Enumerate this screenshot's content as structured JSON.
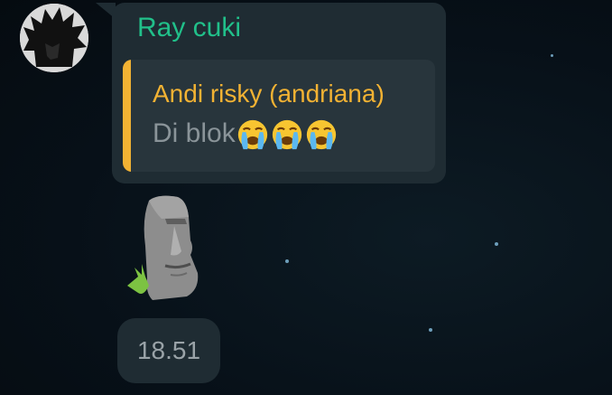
{
  "message": {
    "sender": "Ray cuki",
    "quoted": {
      "author": "Andi risky (andriana)",
      "text": "Di blok",
      "emojis": [
        "loudly-crying-face",
        "loudly-crying-face",
        "loudly-crying-face"
      ]
    },
    "sticker": "moai-icon",
    "time": "18.51"
  },
  "colors": {
    "background": "#071018",
    "bubble": "#1f2c33",
    "sender_name": "#21c08a",
    "quote_accent": "#f2b233",
    "quote_text": "#8a9499",
    "time_text": "#9aa3a8"
  }
}
